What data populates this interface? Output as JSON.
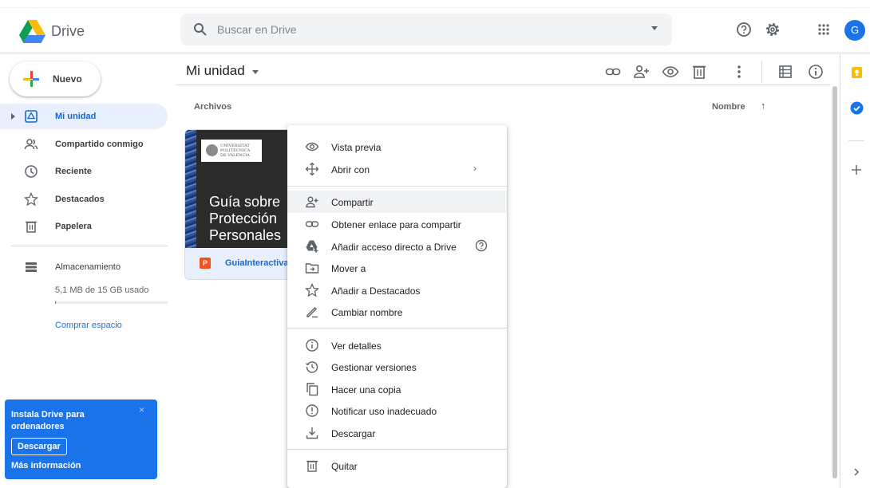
{
  "app": {
    "name": "Drive",
    "avatar_initial": "G"
  },
  "search": {
    "placeholder": "Buscar en Drive"
  },
  "sidebar": {
    "new_label": "Nuevo",
    "items": [
      {
        "label": "Mi unidad",
        "icon": "drive-icon"
      },
      {
        "label": "Compartido conmigo",
        "icon": "shared-people-icon"
      },
      {
        "label": "Reciente",
        "icon": "clock-icon"
      },
      {
        "label": "Destacados",
        "icon": "star-icon"
      },
      {
        "label": "Papelera",
        "icon": "trash-icon"
      }
    ],
    "storage_label": "Almacenamiento",
    "storage_used": "5,1 MB de 15 GB usado",
    "storage_fraction": 0.0003,
    "buy_storage": "Comprar espacio",
    "promo": {
      "title": "Instala Drive para ordenadores",
      "download": "Descargar",
      "more": "Más información",
      "close": "×"
    }
  },
  "main": {
    "title": "Mi unidad",
    "files_heading": "Archivos",
    "sort_label": "Nombre",
    "sort_arrow": "↑"
  },
  "file": {
    "name": "GuiaInteractiva-",
    "type_badge": "P",
    "thumb_logo_lines": [
      "UNIVERSITAT",
      "POLITÈCNICA",
      "DE VALÈNCIA"
    ],
    "thumb_title_lines": [
      "Guía sobre",
      "Protección",
      "Personales"
    ]
  },
  "context_menu": {
    "groups": [
      [
        {
          "label": "Vista previa",
          "icon": "eye-icon"
        },
        {
          "label": "Abrir con",
          "icon": "open-with-icon",
          "submenu": "›"
        }
      ],
      [
        {
          "label": "Compartir",
          "icon": "person-add-icon",
          "highlighted": true
        },
        {
          "label": "Obtener enlace para compartir",
          "icon": "link-icon"
        },
        {
          "label": "Añadir acceso directo a Drive",
          "icon": "drive-shortcut-icon",
          "help": true
        },
        {
          "label": "Mover a",
          "icon": "move-icon"
        },
        {
          "label": "Añadir a Destacados",
          "icon": "star-icon"
        },
        {
          "label": "Cambiar nombre",
          "icon": "pencil-icon"
        }
      ],
      [
        {
          "label": "Ver detalles",
          "icon": "info-icon"
        },
        {
          "label": "Gestionar versiones",
          "icon": "history-icon"
        },
        {
          "label": "Hacer una copia",
          "icon": "copy-icon"
        },
        {
          "label": "Notificar uso inadecuado",
          "icon": "report-icon"
        },
        {
          "label": "Descargar",
          "icon": "download-icon"
        }
      ],
      [
        {
          "label": "Quitar",
          "icon": "trash-icon"
        }
      ]
    ]
  },
  "colors": {
    "accent": "#1a73e8",
    "active_bg": "#e8f0fe",
    "hover_bg": "#f1f3f4"
  }
}
